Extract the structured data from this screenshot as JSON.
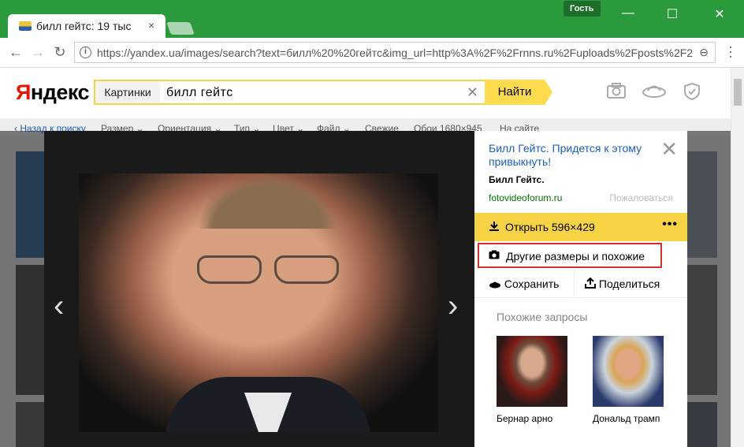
{
  "browser": {
    "tab_title": "билл гейтс: 19 тыс",
    "tab_close": "×",
    "guest_label": "Гость",
    "url": "https://yandex.ua/images/search?text=билл%20%20гейтс&img_url=http%3A%2F%2Frnns.ru%2Fuploads%2Fposts%2F201",
    "window_minimize": "—",
    "window_maximize": "☐",
    "window_close": "✕"
  },
  "header": {
    "logo_first": "Я",
    "logo_rest": "ндекс",
    "search_section": "Картинки",
    "search_query": "билл  гейтс",
    "search_button": "Найти"
  },
  "filters": [
    "‹ Назад к поиску",
    "Размер ⌄",
    "Ориентация ⌄",
    "Тип ⌄",
    "Цвет ⌄",
    "Файл ⌄",
    "Свежие",
    "Обои 1680×945",
    "На сайте"
  ],
  "viewer": {
    "prev_arrow": "‹",
    "next_arrow": "›",
    "title": "Билл Гейтс. Придется к этому привыкнуть!",
    "description": "Билл Гейтс.",
    "site": "fotovideoforum.ru",
    "report": "Пожаловаться",
    "open_label": "Открыть  596×429",
    "more": "•••",
    "similar_label": "Другие размеры и похожие",
    "save_label": "Сохранить",
    "share_label": "Поделиться",
    "related_title": "Похожие запросы",
    "related": [
      {
        "caption": "Бернар арно"
      },
      {
        "caption": "Дональд трамп"
      }
    ]
  }
}
